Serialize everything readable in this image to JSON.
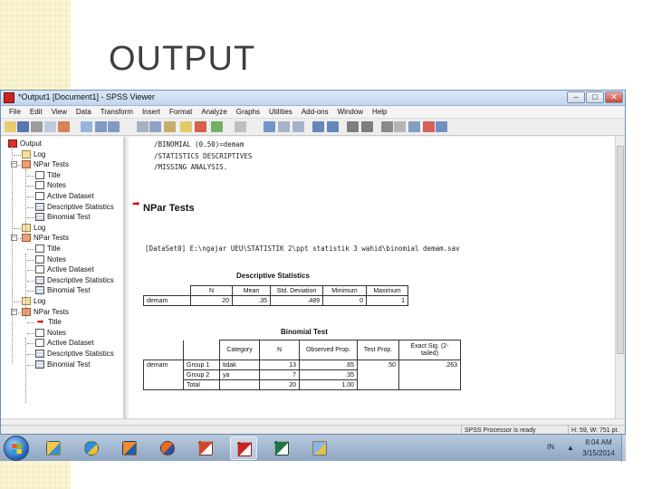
{
  "slide": {
    "title": "OUTPUT"
  },
  "window": {
    "title": "*Output1 [Document1] - SPSS Viewer",
    "buttons": {
      "minimize": "–",
      "maximize": "□",
      "close": "✕"
    }
  },
  "menu": [
    "File",
    "Edit",
    "View",
    "Data",
    "Transform",
    "Insert",
    "Format",
    "Analyze",
    "Graphs",
    "Utilities",
    "Add-ons",
    "Window",
    "Help"
  ],
  "outline": {
    "items": [
      {
        "label": "Output",
        "icon": "root-output-icon"
      },
      {
        "label": "Log",
        "icon": "log-icon"
      },
      {
        "label": "NPar Tests",
        "icon": "npar-tests-icon"
      },
      {
        "label": "Title",
        "icon": "title-icon"
      },
      {
        "label": "Notes",
        "icon": "notes-icon"
      },
      {
        "label": "Active Dataset",
        "icon": "active-dataset-icon"
      },
      {
        "label": "Descriptive Statistics",
        "icon": "table-icon"
      },
      {
        "label": "Binomial Test",
        "icon": "table-icon"
      },
      {
        "label": "Log",
        "icon": "log-icon"
      },
      {
        "label": "NPar Tests",
        "icon": "npar-tests-icon"
      },
      {
        "label": "Title",
        "icon": "title-icon"
      },
      {
        "label": "Notes",
        "icon": "notes-icon"
      },
      {
        "label": "Active Dataset",
        "icon": "active-dataset-icon"
      },
      {
        "label": "Descriptive Statistics",
        "icon": "table-icon"
      },
      {
        "label": "Binomial Test",
        "icon": "table-icon"
      },
      {
        "label": "Log",
        "icon": "log-icon"
      },
      {
        "label": "NPar Tests",
        "icon": "npar-tests-icon"
      },
      {
        "label": "Title",
        "icon": "title-icon"
      },
      {
        "label": "Notes",
        "icon": "notes-icon"
      },
      {
        "label": "Active Dataset",
        "icon": "active-dataset-icon"
      },
      {
        "label": "Descriptive Statistics",
        "icon": "table-icon"
      },
      {
        "label": "Binomial Test",
        "icon": "table-icon"
      }
    ]
  },
  "content": {
    "syntax": [
      "/BINOMIAL (0.50)=demam",
      "/STATISTICS DESCRIPTIVES",
      "/MISSING ANALYSIS."
    ],
    "section_title": "NPar Tests",
    "dataset_line": "[DataSet0] E:\\ngajar UEU\\STATISTIK 2\\ppt statistik 3 wahid\\binomial demam.sav",
    "descriptive": {
      "title": "Descriptive Statistics",
      "headers": [
        "N",
        "Mean",
        "Std. Deviation",
        "Minimum",
        "Maximum"
      ],
      "row_label": "demam",
      "row": [
        "20",
        ".35",
        ".489",
        "0",
        "1"
      ]
    },
    "binomial": {
      "title": "Binomial Test",
      "headers": [
        "Category",
        "N",
        "Observed Prop.",
        "Test Prop.",
        "Exact Sig. (2-tailed)"
      ],
      "var_label": "demam",
      "rows": [
        {
          "group": "Group 1",
          "category": "tidak",
          "n": "13",
          "obs": ".65",
          "test": ".50",
          "sig": ".263"
        },
        {
          "group": "Group 2",
          "category": "ya",
          "n": "7",
          "obs": ".35",
          "test": "",
          "sig": ""
        },
        {
          "group": "Total",
          "category": "",
          "n": "20",
          "obs": "1.00",
          "test": "",
          "sig": ""
        }
      ]
    }
  },
  "status": {
    "processor": "SPSS Processor is ready",
    "size": "H: 59, W: 751 pt."
  },
  "taskbar": {
    "apps": [
      "windows-explorer",
      "internet-explorer",
      "media-player",
      "firefox",
      "powerpoint",
      "spss",
      "excel",
      "paint"
    ],
    "lang": "IN",
    "time": "8:04 AM",
    "date": "3/15/2014"
  },
  "colors": {
    "accent": "#cc1111",
    "titlebar": "#c3d6ee",
    "band": "#fbf5d6"
  }
}
